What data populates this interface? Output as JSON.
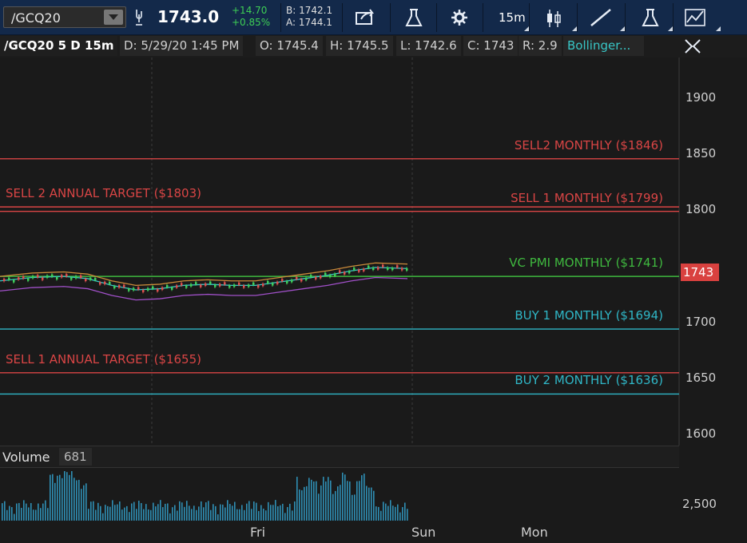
{
  "toolbar": {
    "symbol": "/GCQ20",
    "last_price": "1743.0",
    "change": "+14.70",
    "change_pct": "+0.85%",
    "bid": "B: 1742.1",
    "ask": "A: 1744.1",
    "timeframe": "15m",
    "icons": [
      "link-icon",
      "share-icon",
      "flask-icon",
      "gear-icon",
      "candlestick-icon",
      "drawing-line-icon",
      "studies-flask-icon",
      "pattern-icon"
    ]
  },
  "infobar": {
    "symbol_period": "/GCQ20 5 D 15m",
    "date": "D: 5/29/20 1:45 PM",
    "open": "O: 1745.4",
    "high": "H: 1745.5",
    "low": "L: 1742.6",
    "close": "C: 1743",
    "range": "R: 2.9",
    "study": "Bollinger..."
  },
  "price_levels": [
    {
      "text": "SELL2  MONTHLY  ($1846)",
      "value": 1846,
      "color": "#d94545",
      "side": "right"
    },
    {
      "text": "SELL 2 ANNUAL TARGET ($1803)",
      "value": 1803,
      "color": "#d94545",
      "side": "left"
    },
    {
      "text": "SELL 1  MONTHLY  ($1799)",
      "value": 1799,
      "color": "#d94545",
      "side": "right"
    },
    {
      "text": "VC PMI  MONTHLY  ($1741)",
      "value": 1741,
      "color": "#3fb83f",
      "side": "right"
    },
    {
      "text": "BUY 1  MONTHLY  ($1694)",
      "value": 1694,
      "color": "#2fb6c6",
      "side": "right"
    },
    {
      "text": "SELL 1 ANNUAL TARGET ($1655)",
      "value": 1655,
      "color": "#d94545",
      "side": "left"
    },
    {
      "text": "BUY 2  MONTHLY  ($1636)",
      "value": 1636,
      "color": "#2fb6c6",
      "side": "right"
    }
  ],
  "y_axis": {
    "ticks": [
      "1900",
      "1850",
      "1800",
      "1700",
      "1650",
      "1600"
    ],
    "range": [
      1590,
      1950
    ]
  },
  "current_price_tag": "1743",
  "volume": {
    "label": "Volume",
    "value": "681",
    "tick": "2,500"
  },
  "x_axis": {
    "labels": [
      "Fri",
      "Sun",
      "Mon"
    ]
  },
  "colors": {
    "sell": "#d94545",
    "pmi": "#3fb83f",
    "buy": "#2fb6c6",
    "toolbar": "#13294a",
    "background": "#1a1a1a"
  }
}
